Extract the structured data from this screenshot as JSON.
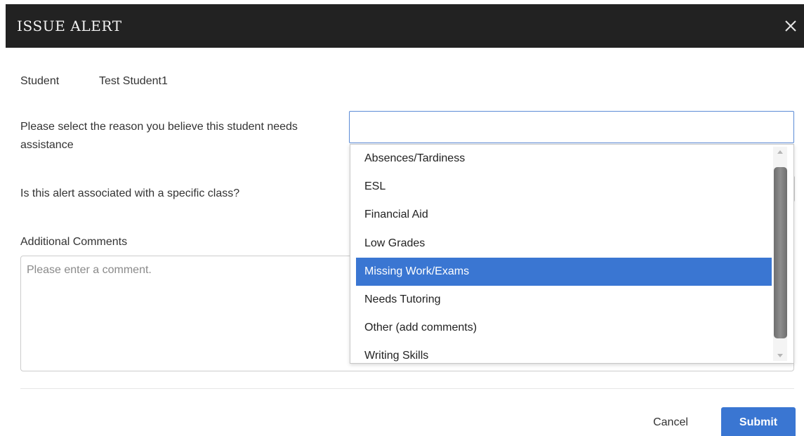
{
  "dialog": {
    "title": "ISSUE ALERT",
    "close_icon": "close-icon"
  },
  "form": {
    "student_label": "Student",
    "student_value": "Test Student1",
    "reason_label": "Please select the reason you believe this student needs assistance",
    "reason_value": "",
    "class_label": "Is this alert associated with a specific class?",
    "comments_label": "Additional Comments",
    "comments_placeholder": "Please enter a comment."
  },
  "dropdown": {
    "options": [
      "Absences/Tardiness",
      "ESL",
      "Financial Aid",
      "Low Grades",
      "Missing Work/Exams",
      "Needs Tutoring",
      "Other (add comments)",
      "Writing Skills"
    ],
    "highlighted": "Missing Work/Exams"
  },
  "footer": {
    "cancel_label": "Cancel",
    "submit_label": "Submit"
  },
  "colors": {
    "header_bg": "#222222",
    "accent": "#3a76d2"
  }
}
